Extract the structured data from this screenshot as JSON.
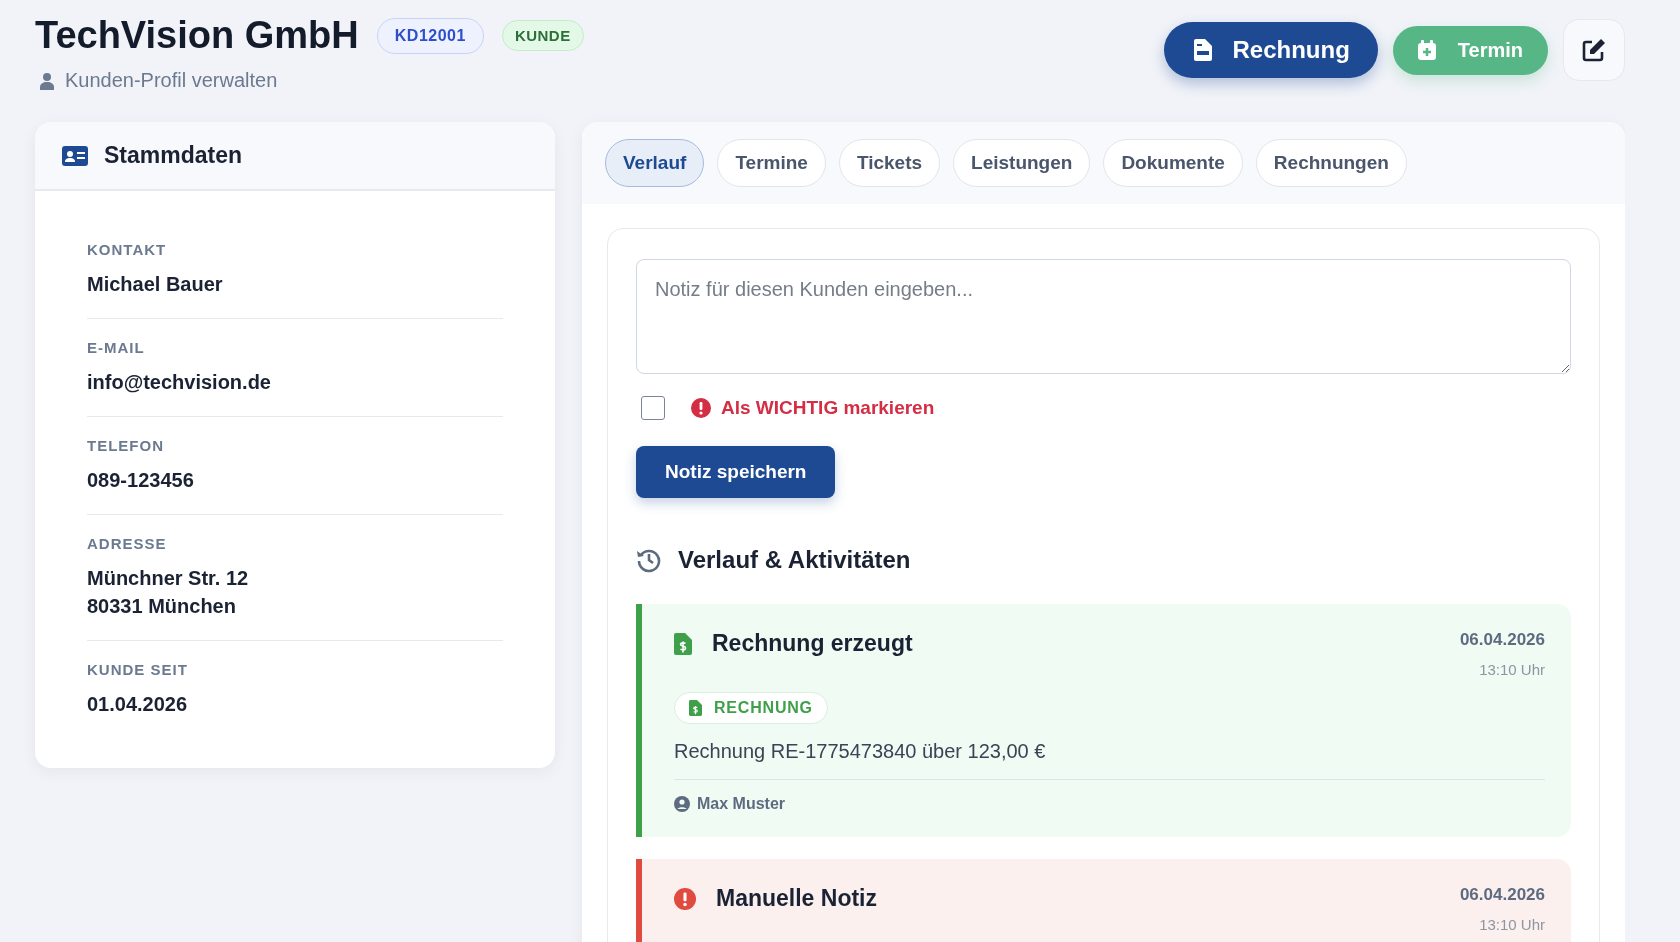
{
  "header": {
    "title": "TechVision GmbH",
    "id_badge": "KD12001",
    "status_badge": "KUNDE",
    "subtitle": "Kunden-Profil verwalten"
  },
  "actions": [
    {
      "kind": "invoice",
      "label": "Rechnung"
    },
    {
      "kind": "appointment",
      "label": "Termin"
    },
    {
      "kind": "edit"
    }
  ],
  "master_data": {
    "title": "Stammdaten",
    "fields": [
      {
        "label": "KONTAKT",
        "lines": [
          "Michael Bauer"
        ]
      },
      {
        "label": "E-MAIL",
        "lines": [
          "info@techvision.de"
        ]
      },
      {
        "label": "TELEFON",
        "lines": [
          "089-123456"
        ]
      },
      {
        "label": "ADRESSE",
        "lines": [
          "Münchner Str. 12",
          "80331 München"
        ]
      },
      {
        "label": "KUNDE SEIT",
        "lines": [
          "01.04.2026"
        ]
      }
    ]
  },
  "tabs": [
    {
      "label": "Verlauf",
      "selected": true
    },
    {
      "label": "Termine",
      "selected": false
    },
    {
      "label": "Tickets",
      "selected": false
    },
    {
      "label": "Leistungen",
      "selected": false
    },
    {
      "label": "Dokumente",
      "selected": false
    },
    {
      "label": "Rechnungen",
      "selected": false
    }
  ],
  "note_form": {
    "placeholder": "Notiz für diesen Kunden eingeben...",
    "important_label": "Als WICHTIG markieren",
    "important_checked": false,
    "save_button": "Notiz speichern"
  },
  "history": {
    "title": "Verlauf & Aktivitäten",
    "entries": [
      {
        "kind": "invoice",
        "title": "Rechnung erzeugt",
        "date": "06.04.2026",
        "time": "13:10 Uhr",
        "tag": "RECHNUNG",
        "text": "Rechnung RE-1775473840 über 123,00 €",
        "author": "Max Muster"
      },
      {
        "kind": "important",
        "title": "Manuelle Notiz",
        "date": "06.04.2026",
        "time": "13:10 Uhr"
      }
    ]
  }
}
